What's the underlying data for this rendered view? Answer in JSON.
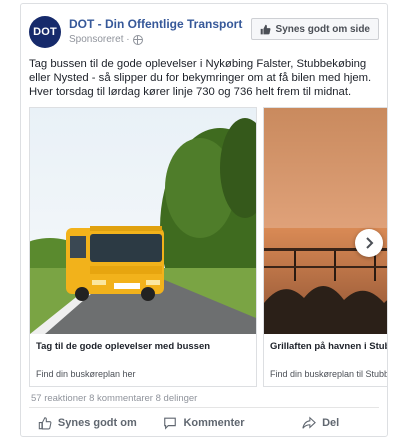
{
  "post": {
    "page_name": "DOT - Din Offentlige Transport",
    "avatar_text": "DOT",
    "sponsored_label": "Sponsoreret ·",
    "like_page_label": "Synes godt om side",
    "body_text": "Tag bussen til de gode oplevelser i Nykøbing Falster, Stubbekøbing eller Nysted - så slipper du for bekymringer om at få bilen med hjem. Hver torsdag til lørdag kører linje 730 og 736 helt frem til midnat."
  },
  "carousel": {
    "slides": [
      {
        "title": "Tag til de gode oplevelser med bussen",
        "link": "Find din buskøreplan her",
        "image": "yellow-bus-on-country-road"
      },
      {
        "title": "Grillaften på havnen i Stubbekøbing",
        "link": "Find din buskøreplan til Stubbekøbing",
        "image": "sunset-over-harbor"
      }
    ],
    "next_icon": "chevron-right-icon"
  },
  "stats": {
    "text": "57 reaktioner  8 kommentarer  8 delinger"
  },
  "actions": {
    "like": "Synes godt om",
    "comment": "Kommenter",
    "share": "Del"
  },
  "colors": {
    "brand": "#162a6b",
    "link": "#365899",
    "bus": "#f2b21b"
  }
}
